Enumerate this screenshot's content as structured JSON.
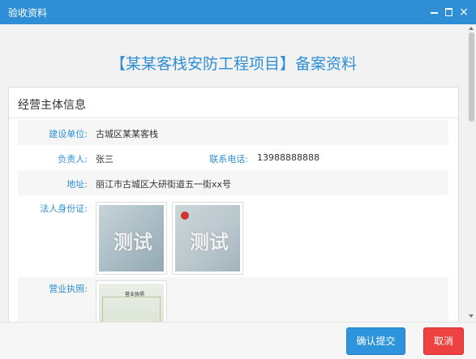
{
  "window": {
    "title": "验收资料",
    "close_glyph": "×"
  },
  "page": {
    "title": "【某某客栈安防工程项目】备案资料"
  },
  "section": {
    "title": "经营主体信息",
    "rows": {
      "construction_unit": {
        "label": "建设单位:",
        "value": "古城区某某客栈"
      },
      "person_in_charge": {
        "label": "负责人:",
        "value": "张三"
      },
      "phone": {
        "label": "联系电话:",
        "value": "13988888888"
      },
      "address": {
        "label": "地址:",
        "value": "丽江市古城区大研街道五一街xx号"
      },
      "legal_id": {
        "label": "法人身份证:",
        "watermark": "测试"
      },
      "business_license": {
        "label": "营业执照:",
        "doc_heading": "营业执照"
      }
    }
  },
  "buttons": {
    "confirm": "确认提交",
    "cancel": "取消"
  },
  "colors": {
    "accent": "#2e8fd6",
    "cancel": "#ee4242",
    "title_bar": "#2e8fd6"
  },
  "icons": [
    "minimize-icon",
    "maximize-icon",
    "close-icon"
  ]
}
